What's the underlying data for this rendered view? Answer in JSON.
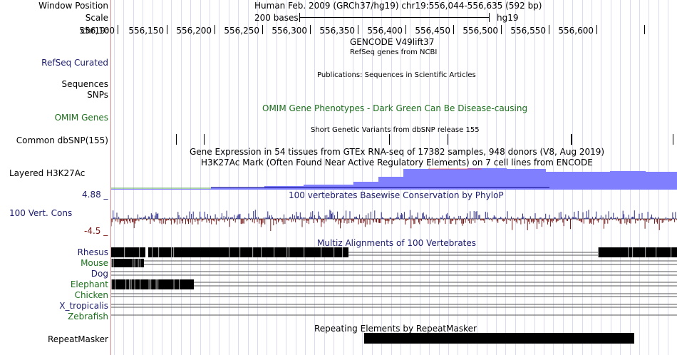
{
  "labels": {
    "window_position": "Window Position",
    "scale": "Scale",
    "chrom": "chr19:",
    "refseq": "RefSeq Curated",
    "sequences": "Sequences",
    "snps": "SNPs",
    "omim": "OMIM Genes",
    "common_dbsnp": "Common dbSNP(155)",
    "layered": "Layered H3K27Ac",
    "cons_max": "4.88 _",
    "cons": "100 Vert. Cons",
    "cons_min": "-4.5 _",
    "species": [
      {
        "name": "Rhesus",
        "color": "#1c1c6e"
      },
      {
        "name": "Mouse",
        "color": "#1a6e1a"
      },
      {
        "name": "Dog",
        "color": "#1c1c6e"
      },
      {
        "name": "Elephant",
        "color": "#1a6e1a"
      },
      {
        "name": "Chicken",
        "color": "#1a6e1a"
      },
      {
        "name": "X_tropicalis",
        "color": "#1c1c6e"
      },
      {
        "name": "Zebrafish",
        "color": "#1a6e1a"
      }
    ],
    "repeatmasker": "RepeatMasker"
  },
  "header": {
    "position_text": "Human Feb. 2009 (GRCh37/hg19)   chr19:556,044-556,635 (592 bp)",
    "scale_text": "200 bases",
    "assembly": "hg19",
    "ticks": [
      "556,100",
      "556,150",
      "556,200",
      "556,250",
      "556,300",
      "556,350",
      "556,400",
      "556,450",
      "556,500",
      "556,550",
      "556,600"
    ]
  },
  "tracks": {
    "gencode": "GENCODE V49lift37",
    "refseq_sub": "RefSeq genes from NCBI",
    "publications": "Publications: Sequences in Scientific Articles",
    "omim_title": "OMIM Gene Phenotypes - Dark Green Can Be Disease-causing",
    "dbsnp_title": "Short Genetic Variants from dbSNP release 155",
    "gtex_title": "Gene Expression in 54 tissues from GTEx RNA-seq of 17382 samples, 948 donors (V8, Aug 2019)",
    "h3k27_title": "H3K27Ac Mark (Often Found Near Active Regulatory Elements) on 7 cell lines from ENCODE",
    "phylop_title": "100 vertebrates Basewise Conservation by PhyloP",
    "multiz_title": "Multiz Alignments of 100 Vertebrates",
    "repeat_title": "Repeating Elements by RepeatMasker"
  },
  "colors": {
    "navy": "#1c1c6e",
    "green": "#1a6e1a",
    "h3k27": "#8080ff",
    "cons_pos": "#2a2a8a",
    "cons_neg": "#7a1a1a",
    "separator": "#d98a8a"
  }
}
